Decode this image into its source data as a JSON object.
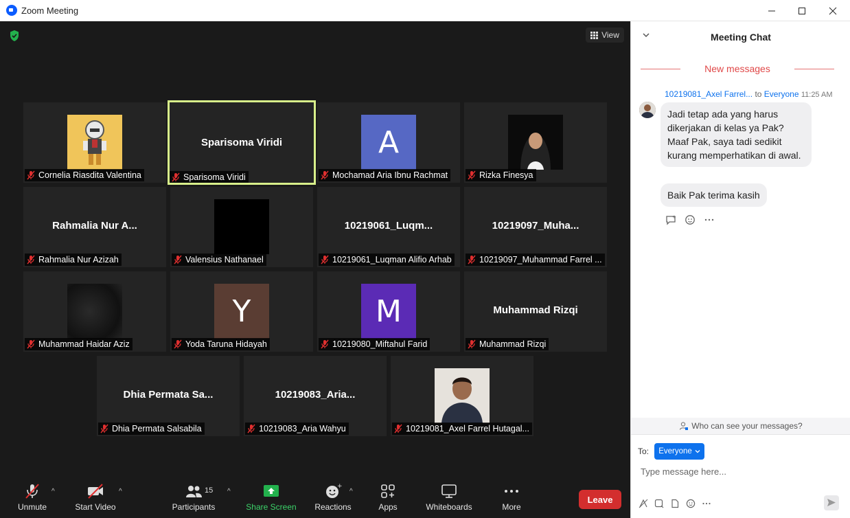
{
  "window": {
    "title": "Zoom Meeting"
  },
  "video": {
    "view_label": "View",
    "tiles": [
      {
        "name": "Cornelia Riasdita Valentina",
        "type": "photo-cartoon"
      },
      {
        "name": "Sparisoma Viridi",
        "display": "Sparisoma Viridi",
        "speaking": true
      },
      {
        "name": "Mochamad Aria Ibnu Rachmat",
        "initial": "A",
        "color": "#5668c4"
      },
      {
        "name": "Rizka Finesya",
        "type": "photo-person"
      },
      {
        "name": "Rahmalia Nur Azizah",
        "display": "Rahmalia Nur A..."
      },
      {
        "name": "Valensius Nathanael",
        "type": "black"
      },
      {
        "name": "10219061_Luqman Alifio Arhab",
        "display": "10219061_Luqm..."
      },
      {
        "name": "10219097_Muhammad Farrel ...",
        "display": "10219097_Muha..."
      },
      {
        "name": "Muhammad Haidar Aziz",
        "type": "blur"
      },
      {
        "name": "Yoda Taruna Hidayah",
        "initial": "Y",
        "color": "#5a3d33"
      },
      {
        "name": "10219080_Miftahul Farid",
        "initial": "M",
        "color": "#5b2bb5"
      },
      {
        "name": "Muhammad Rizqi",
        "display": "Muhammad Rizqi"
      },
      {
        "name": "Dhia Permata Salsabila",
        "display": "Dhia Permata Sa..."
      },
      {
        "name": "10219083_Aria Wahyu",
        "display": "10219083_Aria..."
      },
      {
        "name": "10219081_Axel Farrel Hutagal...",
        "type": "photo-person2"
      }
    ]
  },
  "toolbar": {
    "unmute": "Unmute",
    "start_video": "Start Video",
    "participants": "Participants",
    "participants_count": "15",
    "share_screen": "Share Screen",
    "reactions": "Reactions",
    "apps": "Apps",
    "whiteboards": "Whiteboards",
    "more": "More",
    "leave": "Leave"
  },
  "chat": {
    "title": "Meeting Chat",
    "new_messages": "New messages",
    "sender": "10219081_Axel Farrel...",
    "to_word": "to",
    "recipient": "Everyone",
    "time": "11:25 AM",
    "messages": [
      "Jadi tetap ada yang harus dikerjakan di kelas ya Pak? Maaf Pak, saya tadi sedikit kurang memperhatikan di awal.",
      "Baik Pak terima kasih"
    ],
    "who_can_see": "Who can see your messages?",
    "to_label": "To:",
    "to_value": "Everyone",
    "input_placeholder": "Type message here..."
  },
  "colors": {
    "accent": "#0e72ed",
    "leave": "#d32e2e",
    "speaking_border": "#d8ef8a",
    "share_green": "#3cd36a"
  }
}
